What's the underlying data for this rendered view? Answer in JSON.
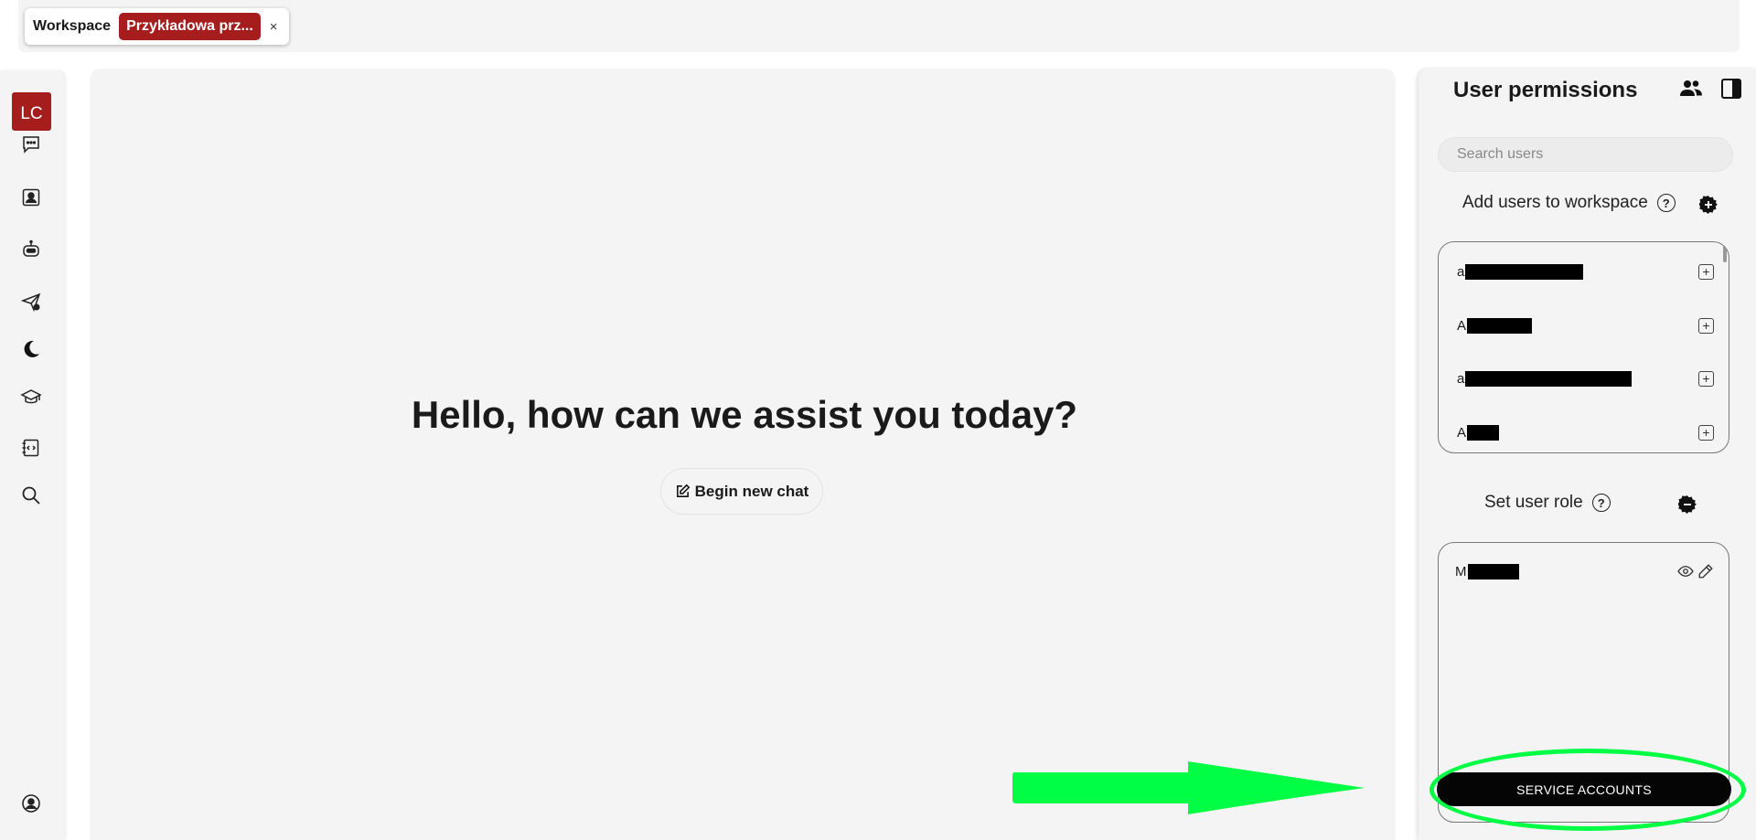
{
  "topbar": {
    "workspace_label": "Workspace",
    "workspace_name": "Przykładowa prz...",
    "close_symbol": "×"
  },
  "rail": {
    "avatar_initials": "LC",
    "avatar_color": "#a51d1d",
    "icons": [
      "chat-icon",
      "contact-card-icon",
      "robot-icon",
      "send-notification-icon",
      "moon-icon",
      "graduation-cap-icon",
      "code-file-icon",
      "search-icon",
      "user-circle-icon"
    ]
  },
  "main": {
    "greeting": "Hello, how can we assist you today?",
    "begin_chat_label": "Begin new chat"
  },
  "permissions": {
    "title": "User permissions",
    "search_placeholder": "Search users",
    "add_users_label": "Add users to workspace",
    "help_symbol": "?",
    "add_users_list": [
      {
        "initial": "a"
      },
      {
        "initial": "A"
      },
      {
        "initial": "a"
      },
      {
        "initial": "A"
      }
    ],
    "set_role_label": "Set user role",
    "role_list": [
      {
        "initial": "M"
      }
    ],
    "service_accounts_label": "SERVICE ACCOUNTS"
  },
  "colors": {
    "accent": "#a51d1d",
    "highlight": "#00ff44",
    "button_dark": "#050505",
    "panel_bg": "#f4f4f4"
  }
}
